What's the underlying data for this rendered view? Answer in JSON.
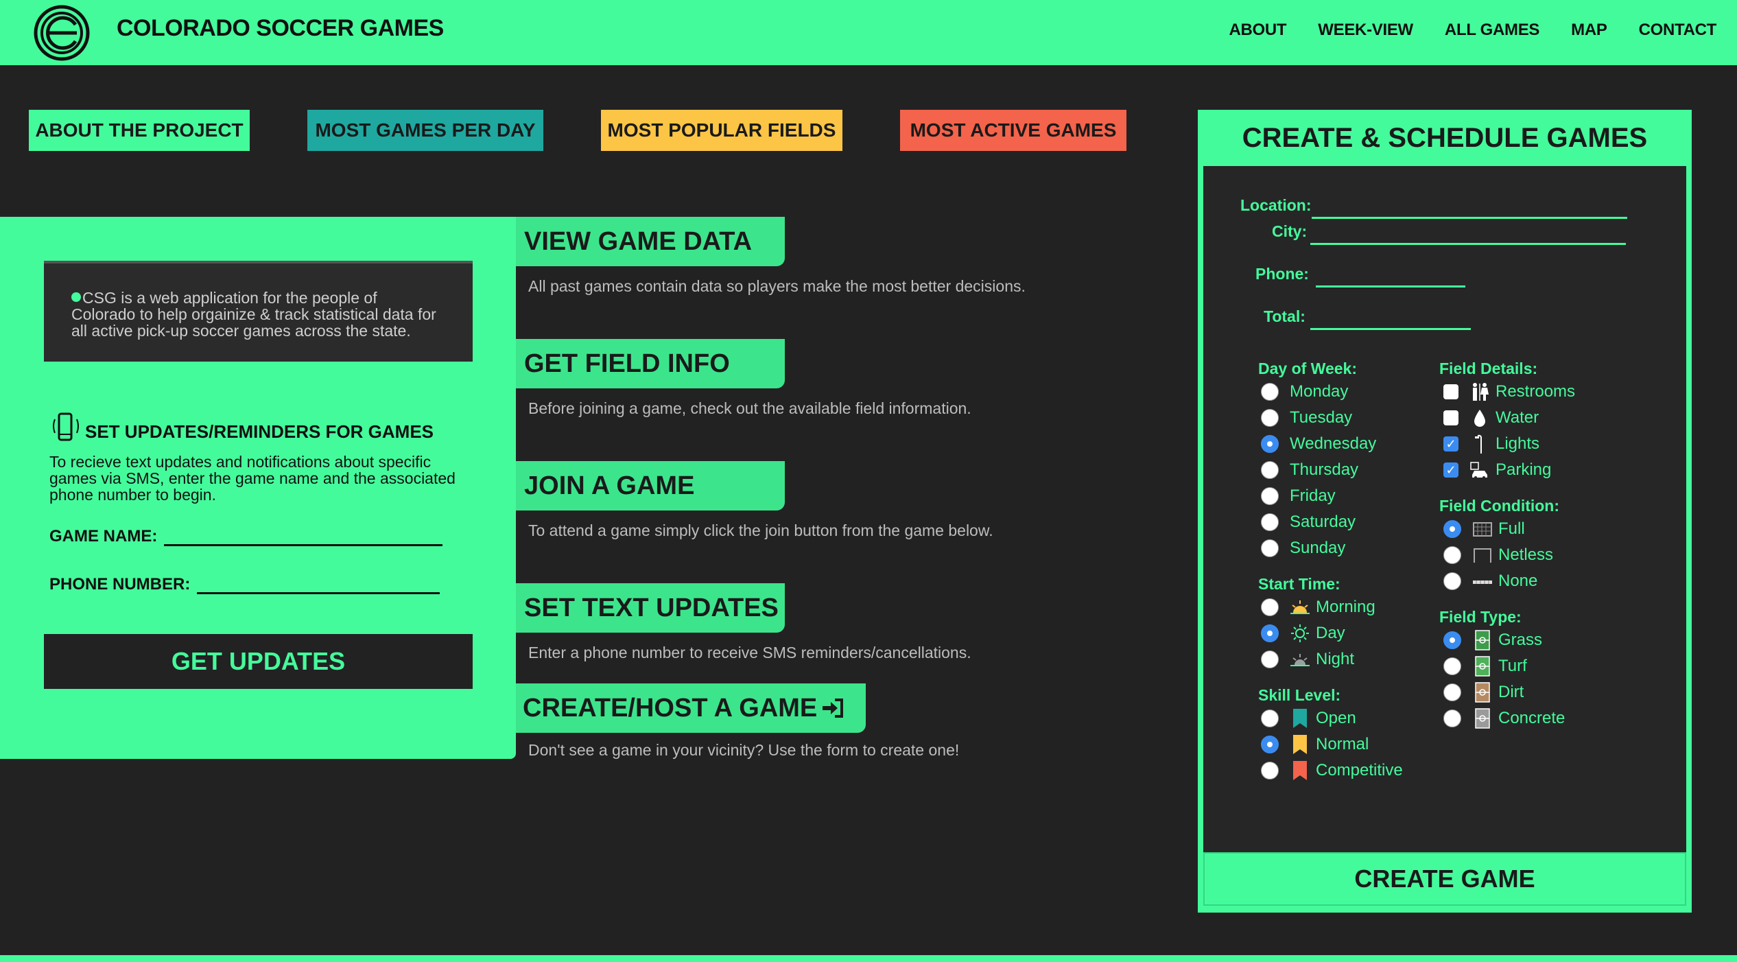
{
  "header": {
    "brand": "COLORADO SOCCER GAMES",
    "nav": [
      "ABOUT",
      "WEEK-VIEW",
      "ALL GAMES",
      "MAP",
      "CONTACT"
    ]
  },
  "top_buttons": [
    {
      "label": "ABOUT THE PROJECT",
      "color": "#44fb9b"
    },
    {
      "label": "MOST GAMES PER DAY",
      "color": "#1fa8a0"
    },
    {
      "label": "MOST POPULAR FIELDS",
      "color": "#fdc545"
    },
    {
      "label": "MOST ACTIVE GAMES",
      "color": "#f4634b"
    }
  ],
  "about": {
    "text": "CSG is a web application for the people of Colorado to help orgainize & track statistical data for all active pick-up soccer games across the state."
  },
  "updates": {
    "title": "SET UPDATES/REMINDERS FOR GAMES",
    "desc": "To recieve text updates and notifications about specific games via SMS, enter the game name and the associated phone number to begin.",
    "game_name_label": "GAME NAME:",
    "phone_label": "PHONE NUMBER:",
    "button": "GET UPDATES"
  },
  "sections": [
    {
      "title": "VIEW GAME DATA",
      "desc": "All past games contain data so players make the most better decisions."
    },
    {
      "title": "GET FIELD INFO",
      "desc": "Before joining a game, check out the available field information."
    },
    {
      "title": "JOIN A GAME",
      "desc": "To attend a game simply click the join button from the game below."
    },
    {
      "title": "SET TEXT UPDATES",
      "desc": "Enter a phone number to receive SMS reminders/cancellations."
    },
    {
      "title": "CREATE/HOST A GAME",
      "desc": "Don't see a game in your vicinity? Use the form to create one!"
    }
  ],
  "form": {
    "title": "CREATE & SCHEDULE GAMES",
    "location_label": "Location:",
    "city_label": "City:",
    "phone_label": "Phone:",
    "total_label": "Total:",
    "day_title": "Day of Week:",
    "days": [
      {
        "label": "Monday",
        "checked": false
      },
      {
        "label": "Tuesday",
        "checked": false
      },
      {
        "label": "Wednesday",
        "checked": true
      },
      {
        "label": "Thursday",
        "checked": false
      },
      {
        "label": "Friday",
        "checked": false
      },
      {
        "label": "Saturday",
        "checked": false
      },
      {
        "label": "Sunday",
        "checked": false
      }
    ],
    "time_title": "Start Time:",
    "times": [
      {
        "label": "Morning",
        "icon": "sunrise-icon",
        "checked": false
      },
      {
        "label": "Day",
        "icon": "sun-icon",
        "checked": true
      },
      {
        "label": "Night",
        "icon": "sunset-icon",
        "checked": false
      }
    ],
    "skill_title": "Skill Level:",
    "skills": [
      {
        "label": "Open",
        "icon": "bookmark-icon",
        "color": "#1fa8a0",
        "checked": false
      },
      {
        "label": "Normal",
        "icon": "bookmark-icon",
        "color": "#fdc545",
        "checked": true
      },
      {
        "label": "Competitive",
        "icon": "bookmark-icon",
        "color": "#f4634b",
        "checked": false
      }
    ],
    "details_title": "Field Details:",
    "details": [
      {
        "label": "Restrooms",
        "icon": "restroom-icon",
        "checked": false
      },
      {
        "label": "Water",
        "icon": "water-drop-icon",
        "checked": false
      },
      {
        "label": "Lights",
        "icon": "street-light-icon",
        "checked": true
      },
      {
        "label": "Parking",
        "icon": "car-icon",
        "checked": true
      }
    ],
    "condition_title": "Field Condition:",
    "conditions": [
      {
        "label": "Full",
        "icon": "goal-net-icon",
        "checked": true
      },
      {
        "label": "Netless",
        "icon": "goal-frame-icon",
        "checked": false
      },
      {
        "label": "None",
        "icon": "field-line-icon",
        "checked": false
      }
    ],
    "type_title": "Field Type:",
    "types": [
      {
        "label": "Grass",
        "icon": "field-icon",
        "color": "#3e9b4a",
        "checked": true
      },
      {
        "label": "Turf",
        "icon": "field-icon",
        "color": "#4fb05a",
        "checked": false
      },
      {
        "label": "Dirt",
        "icon": "field-icon",
        "color": "#b58a62",
        "checked": false
      },
      {
        "label": "Concrete",
        "icon": "field-icon",
        "color": "#9a9a9a",
        "checked": false
      }
    ],
    "submit": "CREATE GAME"
  }
}
